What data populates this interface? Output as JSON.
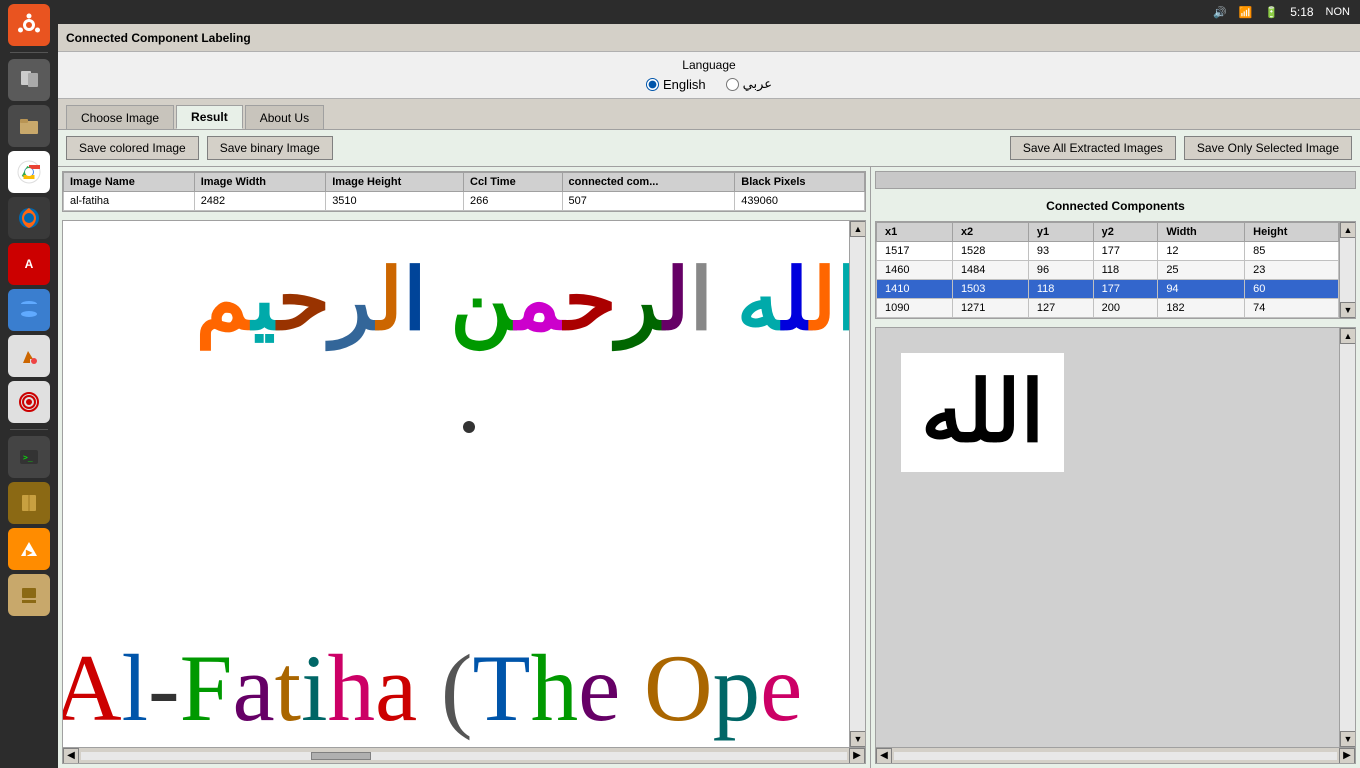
{
  "app": {
    "title": "Connected Component Labeling"
  },
  "topbar": {
    "time": "5:18",
    "lang": "NON"
  },
  "language": {
    "label": "Language",
    "option_english": "English",
    "option_arabic": "عربي"
  },
  "tabs": {
    "choose_image": "Choose Image",
    "result": "Result",
    "about_us": "About Us"
  },
  "buttons": {
    "save_colored": "Save colored Image",
    "save_binary": "Save binary Image",
    "save_extracted": "Save All Extracted Images",
    "save_selected": "Save Only Selected Image"
  },
  "table": {
    "headers": [
      "Image Name",
      "Image Width",
      "Image Height",
      "Ccl Time",
      "connected com...",
      "Black Pixels"
    ],
    "rows": [
      [
        "al-fatiha",
        "2482",
        "3510",
        "266",
        "507",
        "439060"
      ]
    ]
  },
  "cc_panel": {
    "title": "Connected Components",
    "headers": [
      "x1",
      "x2",
      "y1",
      "y2",
      "Width",
      "Height"
    ],
    "rows": [
      [
        "1517",
        "1528",
        "93",
        "177",
        "12",
        "85"
      ],
      [
        "1460",
        "1484",
        "96",
        "118",
        "25",
        "23"
      ],
      [
        "1410",
        "1503",
        "118",
        "177",
        "94",
        "60"
      ],
      [
        "1090",
        "1271",
        "127",
        "200",
        "182",
        "74"
      ]
    ],
    "selected_row": 2
  },
  "image": {
    "arabic_text": "الله الرحمن الرحيم",
    "latin_text": "Al-Fatiha (The Ope",
    "extracted_char": "الله"
  },
  "sidebar": {
    "icons": [
      "ubuntu",
      "files",
      "files2",
      "chrome",
      "firefox",
      "apt",
      "db",
      "paint",
      "target",
      "terminal",
      "book",
      "vlc",
      "stamp"
    ]
  }
}
